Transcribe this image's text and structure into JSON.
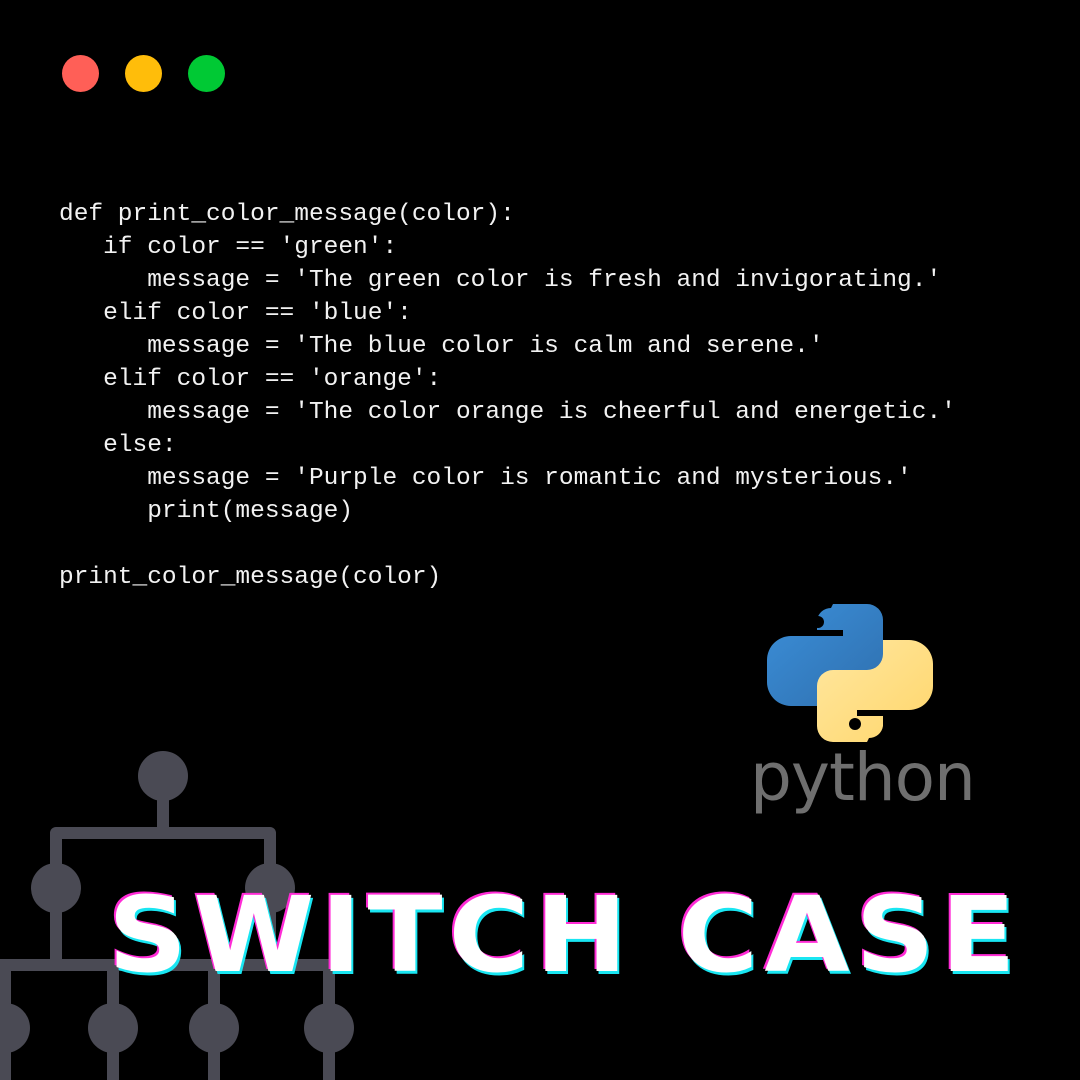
{
  "window": {
    "controls": [
      {
        "name": "close",
        "color": "#ff5f57"
      },
      {
        "name": "minimize",
        "color": "#ffbd0a"
      },
      {
        "name": "maximize",
        "color": "#00c934"
      }
    ]
  },
  "code": {
    "language": "python",
    "lines": [
      "def print_color_message(color):",
      "   if color == 'green':",
      "      message = 'The green color is fresh and invigorating.'",
      "   elif color == 'blue':",
      "      message = 'The blue color is calm and serene.'",
      "   elif color == 'orange':",
      "      message = 'The color orange is cheerful and energetic.'",
      "   else:",
      "      message = 'Purple color is romantic and mysterious.'",
      "      print(message)",
      "",
      "print_color_message(color)"
    ]
  },
  "logo": {
    "icon": "python-logo-icon",
    "wordmark": "python",
    "colors": {
      "blue": "#3a7fc4",
      "yellow": "#ffd873",
      "wordmark": "#6f6f6f"
    }
  },
  "title": "SWITCH CASE",
  "decoration": {
    "icon": "tree-diagram-icon",
    "color": "#4a4a54"
  },
  "colors": {
    "background": "#000000",
    "text": "#f2f2f2",
    "title_shadow_magenta": "#ff2bd6",
    "title_shadow_cyan": "#19e6f2"
  }
}
